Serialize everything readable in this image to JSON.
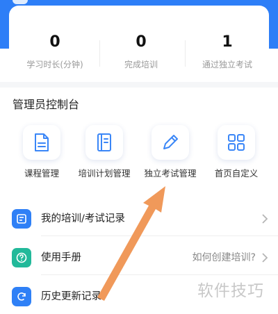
{
  "stats": [
    {
      "value": "0",
      "label": "学习时长(分钟)"
    },
    {
      "value": "0",
      "label": "完成培训"
    },
    {
      "value": "1",
      "label": "通过独立考试"
    }
  ],
  "admin": {
    "title": "管理员控制台",
    "tiles": [
      {
        "label": "课程管理",
        "icon": "document-icon"
      },
      {
        "label": "培训计划管理",
        "icon": "notebook-icon"
      },
      {
        "label": "独立考试管理",
        "icon": "pencil-icon"
      },
      {
        "label": "首页自定义",
        "icon": "grid-icon"
      }
    ]
  },
  "menu": [
    {
      "label": "我的培训/考试记录",
      "hint": "",
      "icon": "record-icon",
      "color": "#2f80f6"
    },
    {
      "label": "使用手册",
      "hint": "如何创建培训?",
      "icon": "help-icon",
      "color": "#22b99a"
    },
    {
      "label": "历史更新记录",
      "hint": "",
      "icon": "refresh-icon",
      "color": "#2f80f6"
    }
  ],
  "watermark": "软件技巧",
  "colors": {
    "brand": "#2d7ef7",
    "accent_arrow": "#f0995a",
    "icon_blue": "#3a86f7"
  }
}
